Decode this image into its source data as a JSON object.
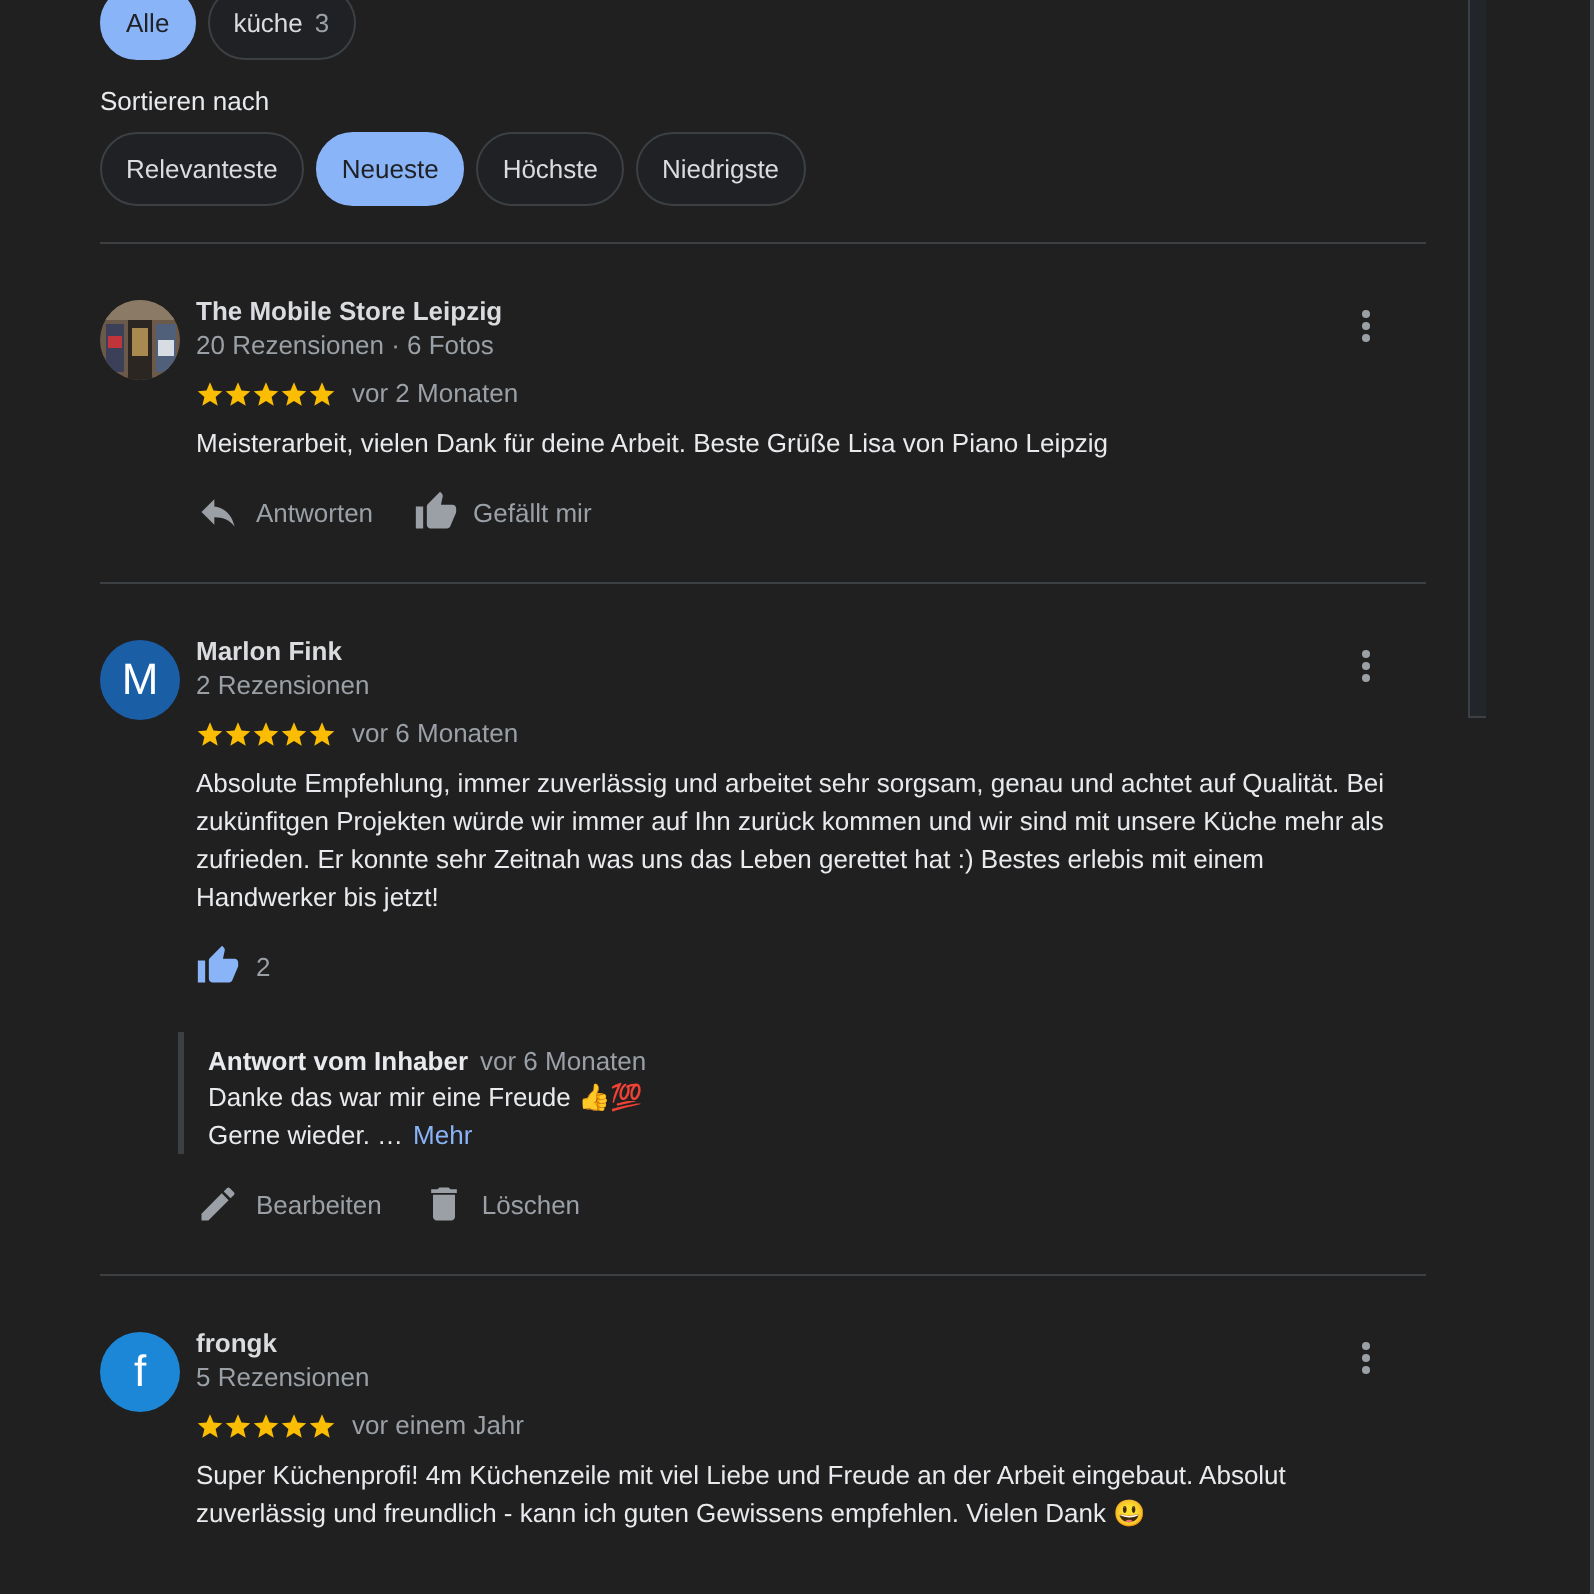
{
  "filters": [
    {
      "label": "Alle",
      "selected": true
    },
    {
      "label": "küche",
      "count": "3",
      "selected": false
    }
  ],
  "sort": {
    "label": "Sortieren nach",
    "options": [
      {
        "label": "Relevanteste",
        "selected": false
      },
      {
        "label": "Neueste",
        "selected": true
      },
      {
        "label": "Höchste",
        "selected": false
      },
      {
        "label": "Niedrigste",
        "selected": false
      }
    ]
  },
  "reviews": [
    {
      "author": "The Mobile Store Leipzig",
      "avatar": {
        "kind": "picture"
      },
      "meta": "20 Rezensionen · 6 Fotos",
      "stars": 5,
      "time": "vor 2 Monaten",
      "text": "Meisterarbeit, vielen Dank für deine Arbeit. Beste Grüße Lisa von Piano Leipzig",
      "actions": [
        {
          "kind": "reply",
          "label": "Antworten"
        },
        {
          "kind": "like",
          "liked": false,
          "label": "Gefällt mir"
        }
      ]
    },
    {
      "author": "Marlon Fink",
      "avatar": {
        "kind": "letter",
        "letter": "M",
        "color": "#1a5ea6"
      },
      "meta": "2 Rezensionen",
      "stars": 5,
      "time": "vor 6 Monaten",
      "text": "Absolute Empfehlung, immer zuverlässig und arbeitet sehr sorgsam, genau und achtet auf Qualität. Bei zukünfitgen Projekten würde wir immer auf Ihn zurück kommen und wir sind mit unsere Küche mehr als zufrieden. Er konnte sehr Zeitnah was uns das Leben gerettet hat :) Bestes erlebis mit einem Handwerker bis jetzt!",
      "actions": [
        {
          "kind": "like",
          "liked": true,
          "label": "2"
        }
      ],
      "owner_reply": {
        "title": "Antwort vom Inhaber",
        "time": "vor 6 Monaten",
        "lines": [
          "Danke das war mir eine Freude 👍💯",
          "Gerne wieder. …"
        ],
        "more": "Mehr",
        "actions": [
          {
            "kind": "edit",
            "label": "Bearbeiten"
          },
          {
            "kind": "delete",
            "label": "Löschen"
          }
        ]
      }
    },
    {
      "author": "frongk",
      "avatar": {
        "kind": "letter",
        "letter": "f",
        "color": "#1b87d6"
      },
      "meta": "5 Rezensionen",
      "stars": 5,
      "time": "vor einem Jahr",
      "text": "Super Küchenprofi! 4m Küchenzeile mit viel Liebe und Freude an der Arbeit eingebaut. Absolut zuverlässig und freundlich - kann ich guten Gewissens empfehlen. Vielen Dank 😃"
    }
  ]
}
